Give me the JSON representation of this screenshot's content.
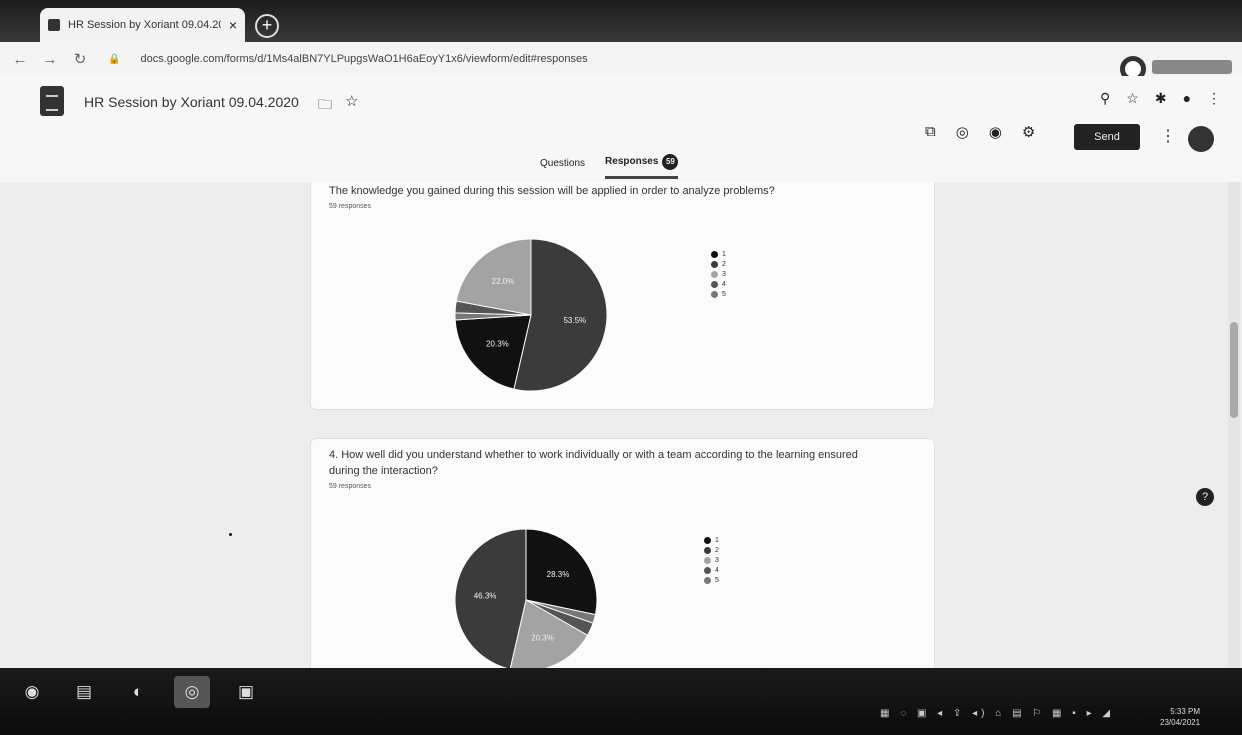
{
  "browser": {
    "tab_title": "HR Session by Xoriant 09.04.20...",
    "tab_close": "×",
    "new_tab": "+",
    "url": "docs.google.com/forms/d/1Ms4alBN7YLPupgsWaO1H6aEoyY1x6/viewform/edit#responses",
    "profile_label": ""
  },
  "form_header": {
    "title": "HR Session by Xoriant 09.04.2020",
    "send_label": "Send",
    "more": "⋮",
    "avatar_initials": "",
    "tabs": [
      {
        "label": "Questions"
      },
      {
        "label": "Responses"
      }
    ],
    "responses_count": "59"
  },
  "questions": [
    {
      "text": "The knowledge you gained during this session will be applied in order to analyze problems?",
      "response_count": "59 responses",
      "legend": [
        "1",
        "2",
        "3",
        "4",
        "5"
      ]
    },
    {
      "text": "4. How well did you understand whether to work individually or with a team according to the learning ensured during the interaction?",
      "response_count": "59 responses",
      "legend": [
        "1",
        "2",
        "3",
        "4",
        "5"
      ]
    }
  ],
  "chart_data": [
    {
      "type": "pie",
      "title": "The knowledge you gained during this session will be applied in order to analyze problems?",
      "categories": [
        "5",
        "1",
        "2",
        "3",
        "4"
      ],
      "values": [
        53.5,
        20.3,
        1.5,
        2.5,
        22.0
      ],
      "labels": [
        "53.5%",
        "20.3%",
        "",
        "",
        "22.0%"
      ],
      "colors": [
        "#3b3b3b",
        "#111111",
        "#777777",
        "#555555",
        "#a3a3a3"
      ],
      "legend_position": "right"
    },
    {
      "type": "pie",
      "title": "4. How well did you understand whether to work individually or with a team according to the learning ensured during the interaction?",
      "categories": [
        "1",
        "2",
        "3",
        "4",
        "5"
      ],
      "values": [
        28.3,
        2.0,
        3.0,
        20.3,
        46.4
      ],
      "labels": [
        "28.3%",
        "",
        "",
        "20.3%",
        "46.3%"
      ],
      "colors": [
        "#111111",
        "#777777",
        "#555555",
        "#a3a3a3",
        "#3b3b3b"
      ],
      "legend_position": "right"
    }
  ],
  "taskbar": {
    "clock_time": "5:33 PM",
    "clock_date": "23/04/2021"
  }
}
